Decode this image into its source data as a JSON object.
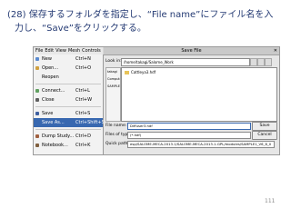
{
  "slide": {
    "title_line1": "(28) 保存するフォルダを指定し、“File name”にファイル名を入",
    "title_line2": "力し、“Save”をクリックする。",
    "page_number": "111"
  },
  "menubar": [
    "File",
    "Edit",
    "View",
    "Mesh",
    "Controls",
    "Modif"
  ],
  "file_menu": [
    {
      "label": "New",
      "shortcut": "Ctrl+N",
      "icon": "new-file-icon",
      "color": "#5a8ad0"
    },
    {
      "label": "Open...",
      "shortcut": "Ctrl+O",
      "icon": "open-folder-icon",
      "color": "#d0a040"
    },
    {
      "label": "Reopen",
      "shortcut": "",
      "icon": "",
      "color": ""
    },
    {
      "sep": true
    },
    {
      "label": "Connect...",
      "shortcut": "Ctrl+L",
      "icon": "connect-icon",
      "color": "#60a060"
    },
    {
      "label": "Close",
      "shortcut": "Ctrl+W",
      "icon": "close-icon",
      "color": "#606060"
    },
    {
      "sep": true
    },
    {
      "label": "Save",
      "shortcut": "Ctrl+S",
      "icon": "save-icon",
      "color": "#4060a0"
    },
    {
      "label": "Save As...",
      "shortcut": "Ctrl+Shift+S",
      "icon": "",
      "color": "",
      "selected": true
    },
    {
      "sep": true
    },
    {
      "label": "Dump Study...",
      "shortcut": "Ctrl+D",
      "icon": "dump-icon",
      "color": "#a06040"
    },
    {
      "label": "Notebook...",
      "shortcut": "Ctrl+K",
      "icon": "notebook-icon",
      "color": "#806040"
    }
  ],
  "dialog": {
    "title": "Save File",
    "look_in_label": "Look in:",
    "look_in_value": "/home/takagi/Salome_Work",
    "sidebar": [
      "takagi",
      "Computer",
      "SAMPLE1"
    ],
    "file_item": "Cattleya3.hdf",
    "file_name_label": "File name:",
    "file_name_value": "Diffuser3.hdf",
    "file_type_label": "Files of type:",
    "file_type_value": "(*.hdf)",
    "quick_path_label": "Quick path:",
    "quick_path_value": "esp/SALOME-MECA-2013.1/SALOME-MECA-2013.1-GPL/modules/SAMPLE1_V6_6_0",
    "save_label": "Save",
    "cancel_label": "Cancel",
    "close_glyph": "✕"
  },
  "colors": {
    "title": "#243a73",
    "selection": "#3868b0"
  }
}
